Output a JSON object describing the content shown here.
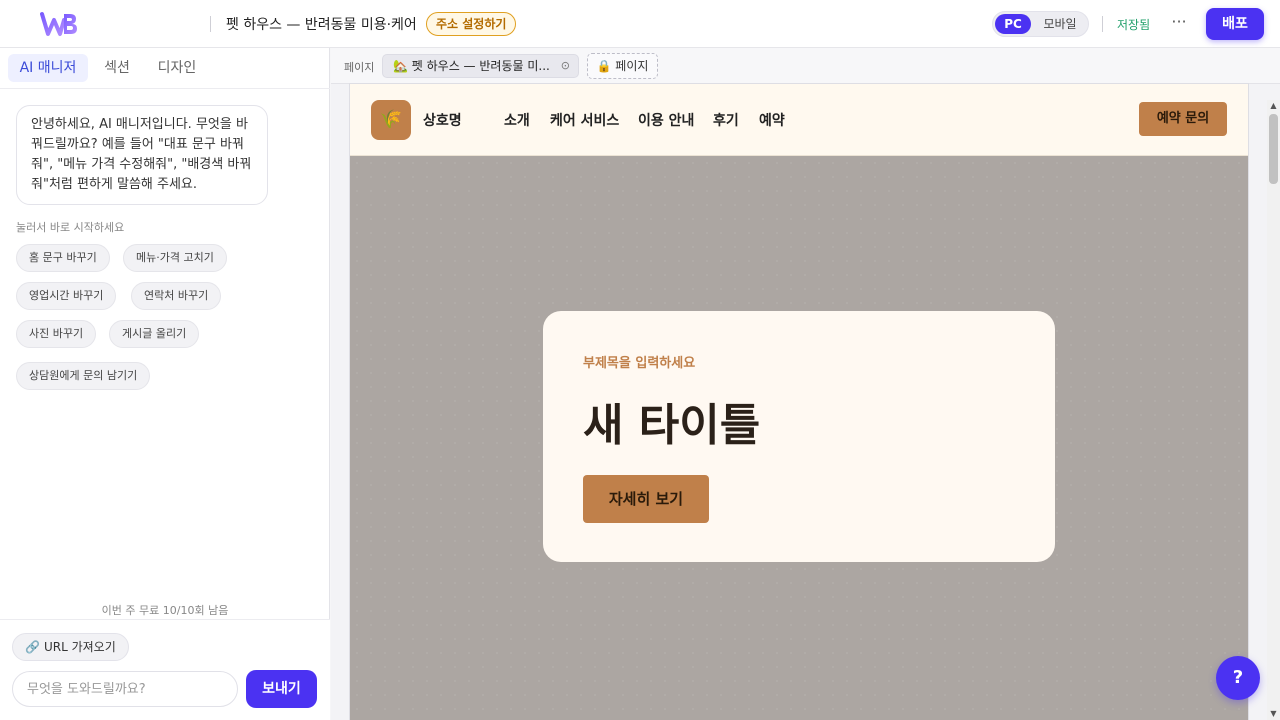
{
  "header": {
    "logo": "WB",
    "site_title": "펫 하우스 — 반려동물 미용·케어",
    "address_badge": "주소 설정하기",
    "device": {
      "pc": "PC",
      "mobile": "모바일"
    },
    "saved_status": "저장됨",
    "more": "···",
    "deploy": "배포"
  },
  "sidebar": {
    "tabs": [
      {
        "label": "AI 매니저",
        "active": true
      },
      {
        "label": "섹션",
        "active": false
      },
      {
        "label": "디자인",
        "active": false
      }
    ],
    "greeting": "안녕하세요, AI 매니저입니다. 무엇을 바꿔드릴까요? 예를 들어 \"대표 문구 바꿔줘\", \"메뉴 가격 수정해줘\", \"배경색 바꿔줘\"처럼 편하게 말씀해 주세요.",
    "hint": "눌러서 바로 시작하세요",
    "chips": [
      "홈 문구 바꾸기",
      "메뉴·가격 고치기",
      "영업시간 바꾸기",
      "연락처 바꾸기",
      "사진 바꾸기",
      "게시글 올리기",
      "상담원에게 문의 남기기"
    ],
    "quota": "이번 주 무료 10/10회 남음",
    "url_button": "URL 가져오기",
    "input_placeholder": "무엇을 도와드릴까요?",
    "send": "보내기"
  },
  "editor": {
    "pages_label": "페이지",
    "page_tab": "🏡 펫 하우스 — 반려동물 미...",
    "page_tab_close": "⊙",
    "add_page": "🔒 페이지"
  },
  "preview": {
    "logo_icon": "🌾",
    "site_name": "상호명",
    "nav": [
      "소개",
      "케어 서비스",
      "이용 안내",
      "후기",
      "예약"
    ],
    "cta": "예약 문의",
    "hero": {
      "subtitle": "부제목을 입력하세요",
      "title": "새 타이틀",
      "button": "자세히 보기"
    }
  },
  "help": "?",
  "colors": {
    "primary": "#4b32f2",
    "accent_brown": "#c0804a",
    "saved_green": "#22a06b",
    "badge_orange": "#e0a020"
  }
}
